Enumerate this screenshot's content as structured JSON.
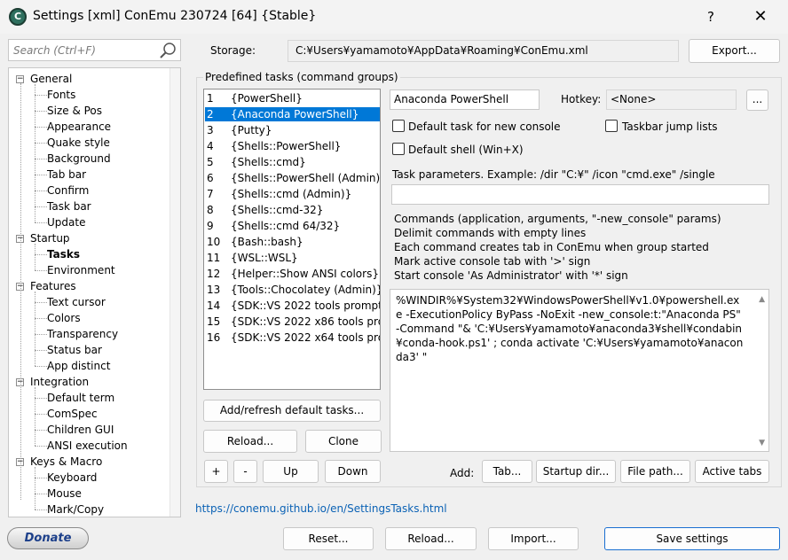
{
  "window": {
    "title": "Settings [xml] ConEmu 230724 [64] {Stable}",
    "help_label": "?",
    "close_label": "✕",
    "icon": "conemu-app-icon"
  },
  "search": {
    "placeholder": "Search (Ctrl+F)"
  },
  "tree": {
    "items": [
      {
        "label": "General",
        "level": 0,
        "expanded": true
      },
      {
        "label": "Fonts",
        "level": 1
      },
      {
        "label": "Size & Pos",
        "level": 1
      },
      {
        "label": "Appearance",
        "level": 1
      },
      {
        "label": "Quake style",
        "level": 1
      },
      {
        "label": "Background",
        "level": 1
      },
      {
        "label": "Tab bar",
        "level": 1
      },
      {
        "label": "Confirm",
        "level": 1
      },
      {
        "label": "Task bar",
        "level": 1
      },
      {
        "label": "Update",
        "level": 1
      },
      {
        "label": "Startup",
        "level": 0,
        "expanded": true
      },
      {
        "label": "Tasks",
        "level": 1,
        "selected": true
      },
      {
        "label": "Environment",
        "level": 1
      },
      {
        "label": "Features",
        "level": 0,
        "expanded": true
      },
      {
        "label": "Text cursor",
        "level": 1
      },
      {
        "label": "Colors",
        "level": 1
      },
      {
        "label": "Transparency",
        "level": 1
      },
      {
        "label": "Status bar",
        "level": 1
      },
      {
        "label": "App distinct",
        "level": 1
      },
      {
        "label": "Integration",
        "level": 0,
        "expanded": true
      },
      {
        "label": "Default term",
        "level": 1
      },
      {
        "label": "ComSpec",
        "level": 1
      },
      {
        "label": "Children GUI",
        "level": 1
      },
      {
        "label": "ANSI execution",
        "level": 1
      },
      {
        "label": "Keys & Macro",
        "level": 0,
        "expanded": true
      },
      {
        "label": "Keyboard",
        "level": 1
      },
      {
        "label": "Mouse",
        "level": 1
      },
      {
        "label": "Mark/Copy",
        "level": 1
      }
    ]
  },
  "storage": {
    "label": "Storage:",
    "path": "C:¥Users¥yamamoto¥AppData¥Roaming¥ConEmu.xml",
    "export_label": "Export..."
  },
  "tasks": {
    "group_label": "Predefined tasks (command groups)",
    "selected_index": 1,
    "items": [
      {
        "num": "1",
        "name": "{PowerShell}"
      },
      {
        "num": "2",
        "name": "{Anaconda PowerShell}"
      },
      {
        "num": "3",
        "name": "{Putty}"
      },
      {
        "num": "4",
        "name": "{Shells::PowerShell}"
      },
      {
        "num": "5",
        "name": "{Shells::cmd}"
      },
      {
        "num": "6",
        "name": "{Shells::PowerShell (Admin)}"
      },
      {
        "num": "7",
        "name": "{Shells::cmd (Admin)}"
      },
      {
        "num": "8",
        "name": "{Shells::cmd-32}"
      },
      {
        "num": "9",
        "name": "{Shells::cmd 64/32}"
      },
      {
        "num": "10",
        "name": "{Bash::bash}"
      },
      {
        "num": "11",
        "name": "{WSL::WSL}"
      },
      {
        "num": "12",
        "name": "{Helper::Show ANSI colors}"
      },
      {
        "num": "13",
        "name": "{Tools::Chocolatey (Admin)}"
      },
      {
        "num": "14",
        "name": "{SDK::VS 2022 tools prompt}"
      },
      {
        "num": "15",
        "name": "{SDK::VS 2022 x86 tools prompt}"
      },
      {
        "num": "16",
        "name": "{SDK::VS 2022 x64 tools prompt}"
      }
    ],
    "add_refresh_label": "Add/refresh default tasks...",
    "reload_label": "Reload...",
    "clone_label": "Clone",
    "plus_label": "+",
    "minus_label": "-",
    "up_label": "Up",
    "down_label": "Down"
  },
  "task_detail": {
    "name": "Anaconda PowerShell",
    "hotkey_label": "Hotkey:",
    "hotkey_value": "<None>",
    "hotkey_btn": "...",
    "default_task_label": "Default task for new console",
    "taskbar_jump_label": "Taskbar jump lists",
    "default_shell_label": "Default shell (Win+X)",
    "params_label": "Task parameters. Example: /dir \"C:¥\" /icon \"cmd.exe\" /single",
    "params_value": "",
    "info_lines": [
      "Commands (application, arguments, \"-new_console\" params)",
      "Delimit commands with empty lines",
      "Each command creates tab in ConEmu when group started",
      "Mark active console tab with '>' sign",
      "Start console 'As Administrator' with '*' sign"
    ],
    "commands": "%WINDIR%¥System32¥WindowsPowerShell¥v1.0¥powershell.exe -ExecutionPolicy ByPass -NoExit -new_console:t:\"Anaconda PS\" -Command \"& 'C:¥Users¥yamamoto¥anaconda3¥shell¥condabin¥conda-hook.ps1' ; conda activate 'C:¥Users¥yamamoto¥anaconda3' \"",
    "add_label": "Add:",
    "tab_btn": "Tab...",
    "startup_dir_btn": "Startup dir...",
    "file_path_btn": "File path...",
    "active_tabs_btn": "Active tabs"
  },
  "footer": {
    "link": "https://conemu.github.io/en/SettingsTasks.html",
    "donate_label": "Donate",
    "reset_label": "Reset...",
    "reload_label": "Reload...",
    "import_label": "Import...",
    "save_label": "Save settings"
  }
}
